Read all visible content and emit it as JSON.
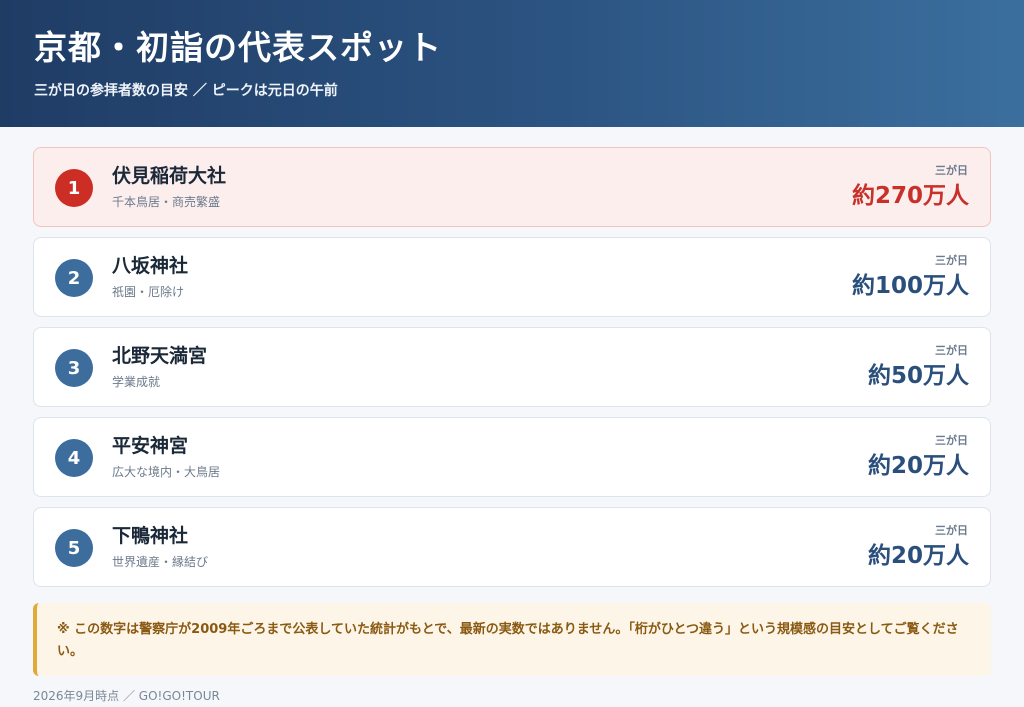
{
  "header": {
    "title": "京都・初詣の代表スポット",
    "subtitle": "三が日の参拝者数の目安 ／ ピークは元日の午前"
  },
  "spots": [
    {
      "rank": "1",
      "name": "伏見稲荷大社",
      "desc": "千本鳥居・商売繁盛",
      "period": "三が日",
      "count": "約270万人"
    },
    {
      "rank": "2",
      "name": "八坂神社",
      "desc": "祇園・厄除け",
      "period": "三が日",
      "count": "約100万人"
    },
    {
      "rank": "3",
      "name": "北野天満宮",
      "desc": "学業成就",
      "period": "三が日",
      "count": "約50万人"
    },
    {
      "rank": "4",
      "name": "平安神宮",
      "desc": "広大な境内・大鳥居",
      "period": "三が日",
      "count": "約20万人"
    },
    {
      "rank": "5",
      "name": "下鴨神社",
      "desc": "世界遺産・縁結び",
      "period": "三が日",
      "count": "約20万人"
    }
  ],
  "note": "※ この数字は警察庁が2009年ごろまで公表していた統計がもとで、最新の実数ではありません。「桁がひとつ違う」という規模感の目安としてご覧ください。",
  "footer": "2026年9月時点 ／ GO!GO!TOUR",
  "colors": {
    "header_start": "#1f3c65",
    "header_end": "#3b6f9e",
    "accent_red": "#cc2e26",
    "accent_blue": "#3d6d9c",
    "note_border": "#e1a93a"
  }
}
